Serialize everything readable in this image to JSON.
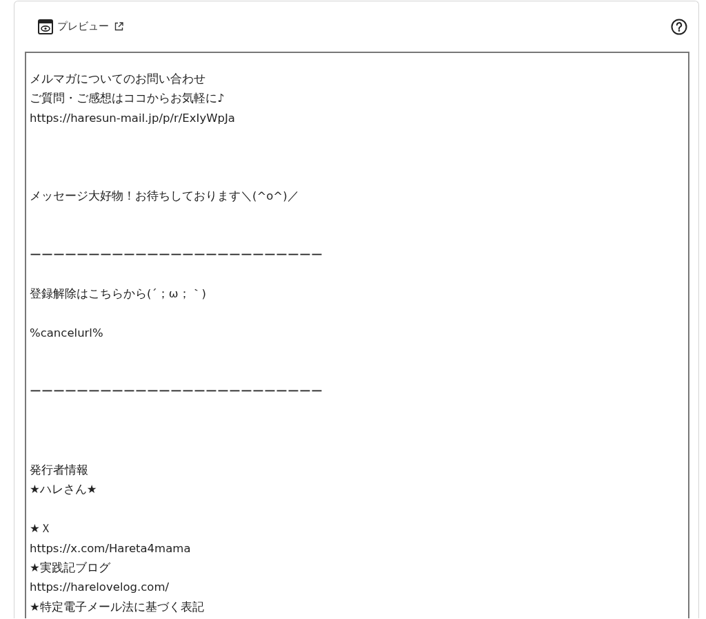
{
  "header": {
    "title": "プレビュー"
  },
  "preview": {
    "lines": [
      {
        "kind": "text",
        "text": "メルマガについてのお問い合わせ"
      },
      {
        "kind": "text",
        "text": "ご質問・ご感想はココからお気軽に♪"
      },
      {
        "kind": "text",
        "text": "https://haresun-mail.jp/p/r/ExIyWpJa"
      },
      {
        "kind": "blank"
      },
      {
        "kind": "blank"
      },
      {
        "kind": "blank"
      },
      {
        "kind": "text",
        "text": "メッセージ大好物！お待ちしております＼(^o^)／"
      },
      {
        "kind": "blank"
      },
      {
        "kind": "blank"
      },
      {
        "kind": "text",
        "text": "ーーーーーーーーーーーーーーーーーーーーーーーーー"
      },
      {
        "kind": "blank"
      },
      {
        "kind": "text",
        "text": "登録解除はこちらから(´；ω；｀)"
      },
      {
        "kind": "blank"
      },
      {
        "kind": "text",
        "text": "%cancelurl%"
      },
      {
        "kind": "blank"
      },
      {
        "kind": "blank"
      },
      {
        "kind": "text",
        "text": "ーーーーーーーーーーーーーーーーーーーーーーーーー"
      },
      {
        "kind": "blank"
      },
      {
        "kind": "blank"
      },
      {
        "kind": "blank"
      },
      {
        "kind": "text",
        "text": "発行者情報"
      },
      {
        "kind": "text",
        "text": "★ハレさん★"
      },
      {
        "kind": "blank"
      },
      {
        "kind": "text",
        "text": "★Ｘ"
      },
      {
        "kind": "text",
        "text": "https://x.com/Hareta4mama"
      },
      {
        "kind": "text",
        "text": "★実践記ブログ"
      },
      {
        "kind": "text",
        "text": "https://harelovelog.com/"
      },
      {
        "kind": "text",
        "text": "★特定電子メール法に基づく表記"
      }
    ]
  }
}
